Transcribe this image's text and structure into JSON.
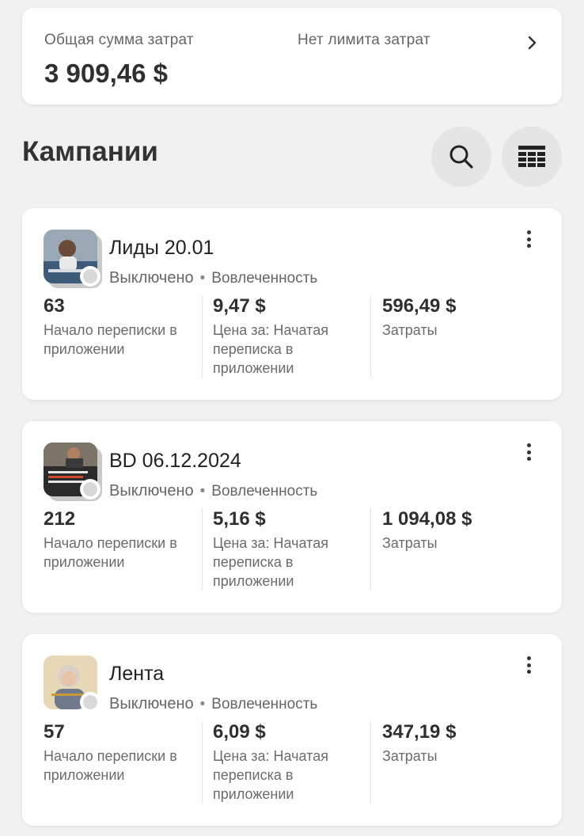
{
  "summary": {
    "total_label": "Общая сумма затрат",
    "total_value": "3 909,46 $",
    "limit_label": "Нет лимита затрат"
  },
  "section": {
    "title": "Кампании"
  },
  "icons": {
    "search": "search-icon",
    "table": "table-view-icon",
    "more": "more-vertical-icon",
    "chevron": "chevron-right-icon"
  },
  "campaigns": [
    {
      "name": "Лиды 20.01",
      "status": "Выключено",
      "objective": "Вовлеченность",
      "results": "63",
      "results_label": "Начало переписки в приложении",
      "cost": "9,47 $",
      "cost_label": "Цена за: Начатая переписка в приложении",
      "spend": "596,49 $",
      "spend_label": "Затраты"
    },
    {
      "name": "BD 06.12.2024",
      "status": "Выключено",
      "objective": "Вовлеченность",
      "results": "212",
      "results_label": "Начало переписки в приложении",
      "cost": "5,16 $",
      "cost_label": "Цена за: Начатая переписка в приложении",
      "spend": "1 094,08 $",
      "spend_label": "Затраты"
    },
    {
      "name": "Лента",
      "status": "Выключено",
      "objective": "Вовлеченность",
      "results": "57",
      "results_label": "Начало переписки в приложении",
      "cost": "6,09 $",
      "cost_label": "Цена за: Начатая переписка в приложении",
      "spend": "347,19 $",
      "spend_label": "Затраты"
    }
  ]
}
